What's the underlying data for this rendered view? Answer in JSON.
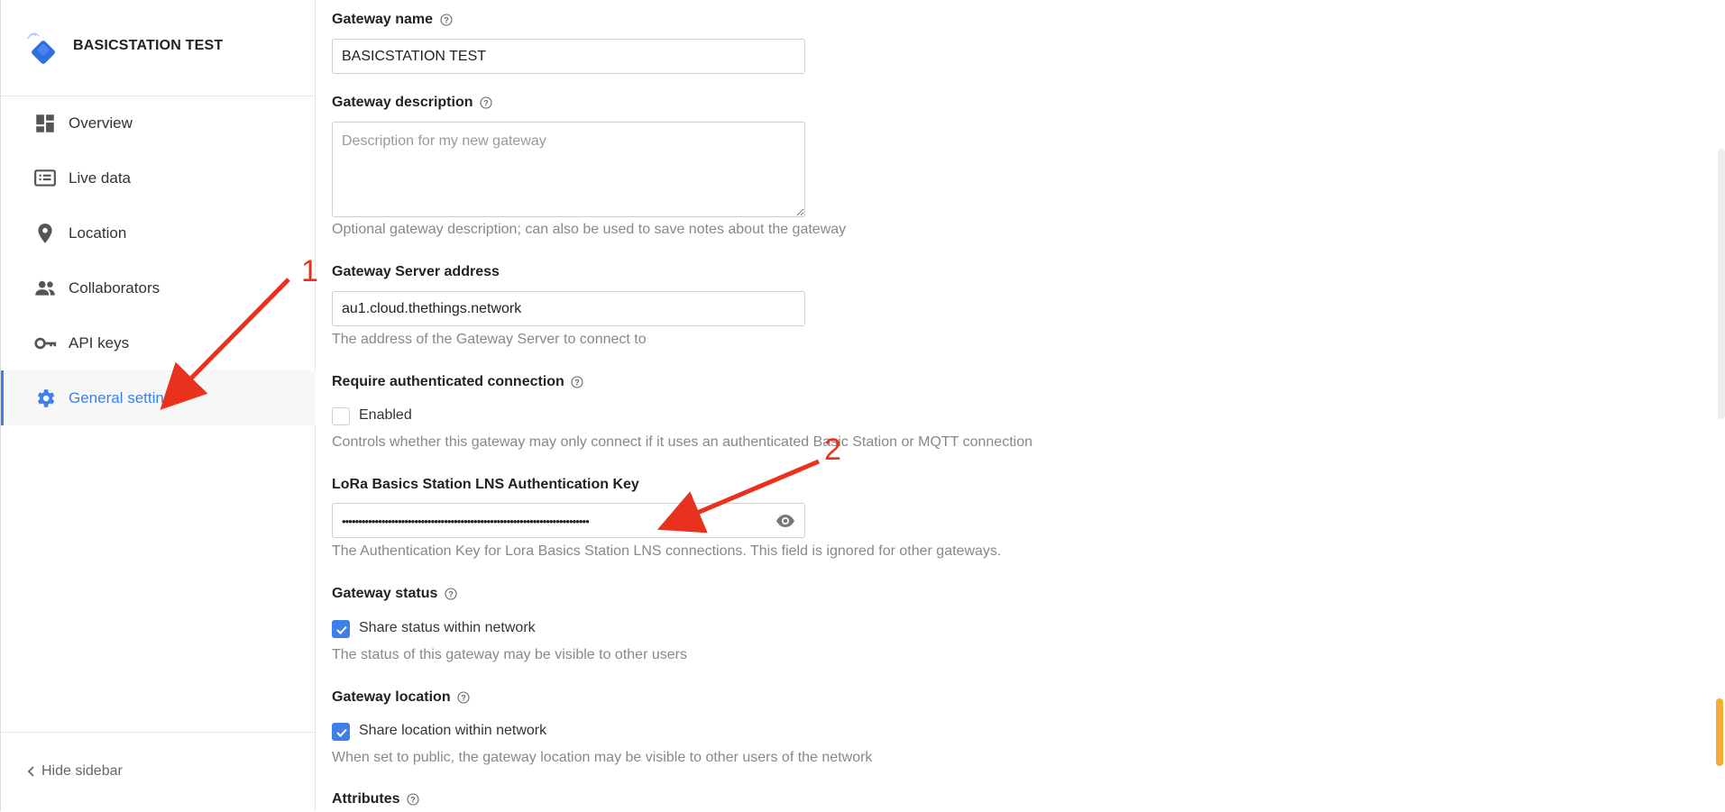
{
  "sidebar": {
    "brand_title": "BASICSTATION TEST",
    "items": [
      {
        "label": "Overview",
        "icon": "dashboard-icon"
      },
      {
        "label": "Live data",
        "icon": "live-data-icon"
      },
      {
        "label": "Location",
        "icon": "location-pin-icon"
      },
      {
        "label": "Collaborators",
        "icon": "people-icon"
      },
      {
        "label": "API keys",
        "icon": "key-icon"
      },
      {
        "label": "General settings",
        "icon": "gear-icon",
        "active": true
      }
    ],
    "hide_label": "Hide sidebar"
  },
  "form": {
    "gateway_name": {
      "label": "Gateway name",
      "value": "BASICSTATION TEST"
    },
    "gateway_description": {
      "label": "Gateway description",
      "placeholder": "Description for my new gateway",
      "help": "Optional gateway description; can also be used to save notes about the gateway"
    },
    "server_address": {
      "label": "Gateway Server address",
      "value": "au1.cloud.thethings.network",
      "help": "The address of the Gateway Server to connect to"
    },
    "require_auth": {
      "label": "Require authenticated connection",
      "checkbox_label": "Enabled",
      "checked": false,
      "help": "Controls whether this gateway may only connect if it uses an authenticated Basic Station or MQTT connection"
    },
    "lns_key": {
      "label": "LoRa Basics Station LNS Authentication Key",
      "masked_value": "•••••••••••••••••••••••••••••••••••••••••••••••••••••••••••••••••••••••••••",
      "help": "The Authentication Key for Lora Basics Station LNS connections. This field is ignored for other gateways."
    },
    "gateway_status": {
      "label": "Gateway status",
      "checkbox_label": "Share status within network",
      "checked": true,
      "help": "The status of this gateway may be visible to other users"
    },
    "gateway_location": {
      "label": "Gateway location",
      "checkbox_label": "Share location within network",
      "checked": true,
      "help": "When set to public, the gateway location may be visible to other users of the network"
    },
    "attributes": {
      "label": "Attributes"
    }
  },
  "annotations": {
    "one": "1",
    "two": "2"
  },
  "colors": {
    "accent": "#3f7fe9",
    "annotation": "#e8321e"
  }
}
